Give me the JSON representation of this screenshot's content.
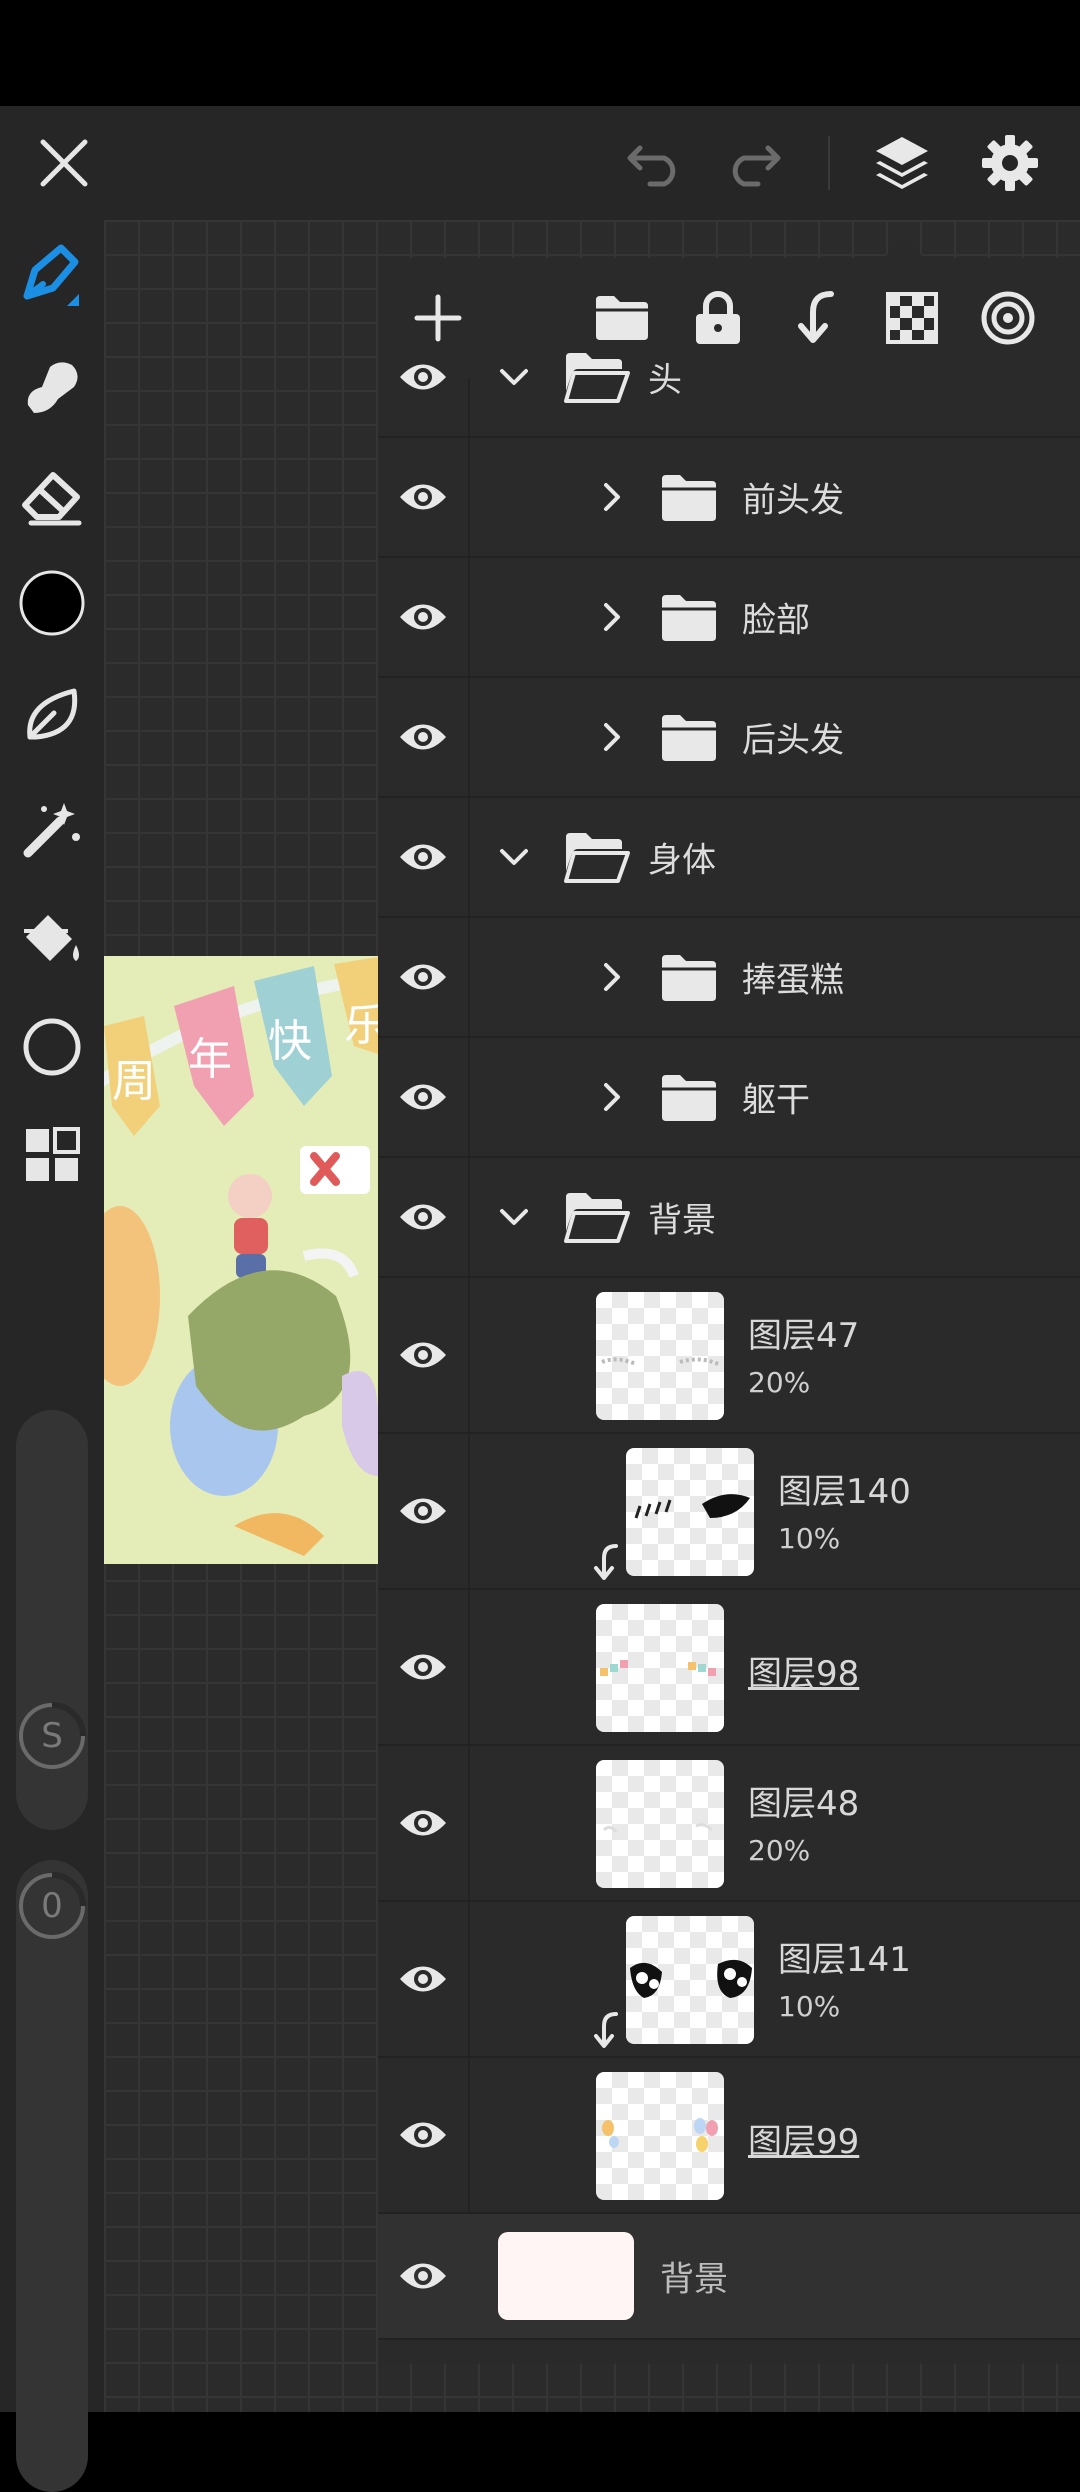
{
  "app": {
    "colors": {
      "accent": "#1a8fe3",
      "topbar_bg": "#262626",
      "panel_bg": "#2a2a2a",
      "primary_color_swatch": "#000000",
      "background_layer_color": "#fff5f5"
    }
  },
  "topbar": {
    "close_icon": "close-icon",
    "undo_icon": "undo-icon",
    "redo_icon": "redo-icon",
    "layers_icon": "layers-icon",
    "settings_icon": "gear-icon"
  },
  "tools": [
    {
      "name": "brush-tool",
      "icon": "brush-icon",
      "active": true
    },
    {
      "name": "smudge-tool",
      "icon": "smudge-icon"
    },
    {
      "name": "eraser-tool",
      "icon": "eraser-icon"
    },
    {
      "name": "color-picker",
      "icon": "color-circle"
    },
    {
      "name": "lasso-tool",
      "icon": "leaf-icon"
    },
    {
      "name": "magic-wand-tool",
      "icon": "magic-wand-icon"
    },
    {
      "name": "fill-tool",
      "icon": "paint-bucket-icon"
    },
    {
      "name": "shape-tool",
      "icon": "circle-icon"
    },
    {
      "name": "more-tools",
      "icon": "grid-icon"
    }
  ],
  "sliders": {
    "size_label": "S",
    "opacity_label": "0"
  },
  "artwork": {
    "banner_text": [
      "周",
      "年",
      "快",
      "乐"
    ]
  },
  "layers_panel": {
    "toolbar_icons": [
      "add-icon",
      "folder-icon",
      "lock-icon",
      "merge-down-icon",
      "checkerboard-icon",
      "target-icon"
    ],
    "rows": [
      {
        "type": "folder",
        "label": "头",
        "expanded": true,
        "indent": 0
      },
      {
        "type": "folder",
        "label": "前头发",
        "expanded": false,
        "indent": 1
      },
      {
        "type": "folder",
        "label": "脸部",
        "expanded": false,
        "indent": 1
      },
      {
        "type": "folder",
        "label": "后头发",
        "expanded": false,
        "indent": 1
      },
      {
        "type": "folder",
        "label": "身体",
        "expanded": true,
        "indent": 0
      },
      {
        "type": "folder",
        "label": "捧蛋糕",
        "expanded": false,
        "indent": 1
      },
      {
        "type": "folder",
        "label": "躯干",
        "expanded": false,
        "indent": 1
      },
      {
        "type": "folder",
        "label": "背景",
        "expanded": true,
        "indent": 0
      }
    ],
    "layers": [
      {
        "name": "图层47",
        "opacity": "20%",
        "clipped": false,
        "underline": false
      },
      {
        "name": "图层140",
        "opacity": "10%",
        "clipped": true,
        "underline": false
      },
      {
        "name": "图层98",
        "opacity": "",
        "clipped": false,
        "underline": true
      },
      {
        "name": "图层48",
        "opacity": "20%",
        "clipped": false,
        "underline": false
      },
      {
        "name": "图层141",
        "opacity": "10%",
        "clipped": true,
        "underline": false
      },
      {
        "name": "图层99",
        "opacity": "",
        "clipped": false,
        "underline": true
      }
    ],
    "background_layer": {
      "label": "背景"
    }
  }
}
